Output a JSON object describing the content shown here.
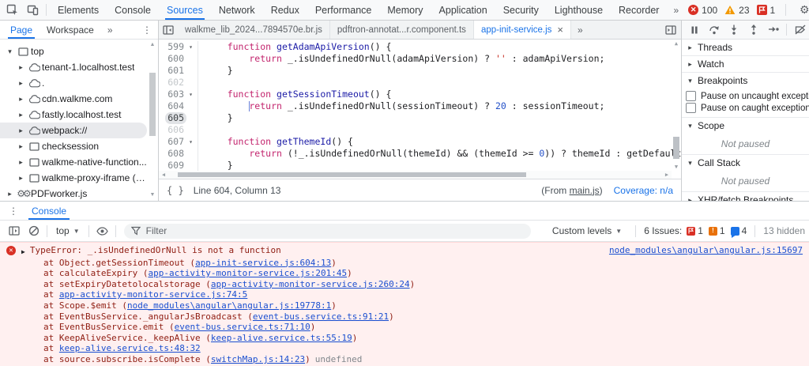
{
  "glyphs": {
    "more": "»",
    "menu": "⋮",
    "close": "×",
    "caret": "▼",
    "arrow_collapsed": "▸",
    "arrow_expanded": "▾",
    "up": "▲",
    "down": "▼",
    "left": "◀",
    "right": "▶",
    "gear": "⚙",
    "braces": "{ }",
    "flag": "⚑",
    "bang": "!",
    "x": "✕"
  },
  "topbar": {
    "tabs": [
      "Elements",
      "Console",
      "Sources",
      "Network",
      "Redux",
      "Performance",
      "Memory",
      "Application",
      "Security",
      "Lighthouse",
      "Recorder"
    ],
    "active": "Sources",
    "error_count": "100",
    "warning_count": "23",
    "issue_count": "1"
  },
  "sidebar": {
    "tabs": [
      "Page",
      "Workspace"
    ],
    "active": "Page",
    "tree": [
      {
        "label": "top",
        "icon": "frame",
        "expanded": true,
        "depth": 0
      },
      {
        "label": "tenant-1.localhost.test",
        "icon": "cloud",
        "depth": 1
      },
      {
        "label": ".",
        "icon": "cloud",
        "depth": 1
      },
      {
        "label": "cdn.walkme.com",
        "icon": "cloud",
        "depth": 1
      },
      {
        "label": "fastly.localhost.test",
        "icon": "cloud",
        "depth": 1
      },
      {
        "label": "webpack://",
        "icon": "cloud",
        "depth": 1,
        "selected": true
      },
      {
        "label": "checksession",
        "icon": "frame",
        "depth": 1
      },
      {
        "label": "walkme-native-function...",
        "icon": "frame",
        "depth": 1
      },
      {
        "label": "walkme-proxy-iframe (a...",
        "icon": "frame",
        "depth": 1
      },
      {
        "label": "PDFworker.js",
        "icon": "worker",
        "depth": 0
      }
    ]
  },
  "editor": {
    "tabs": [
      {
        "label": "walkme_lib_2024...7894570e.br.js",
        "active": false,
        "closable": false
      },
      {
        "label": "pdftron-annotat...r.component.ts",
        "active": false,
        "closable": false
      },
      {
        "label": "app-init-service.js",
        "active": true,
        "closable": true
      }
    ],
    "lines": [
      {
        "num": "599",
        "fold": true,
        "tokens": [
          [
            "kw",
            "    function"
          ],
          [
            "fn",
            " getAdamApiVersion"
          ],
          [
            "pl",
            "() {"
          ]
        ]
      },
      {
        "num": "600",
        "tokens": [
          [
            "kw",
            "        return"
          ],
          [
            "pl",
            " _.isUndefinedOrNull(adamApiVersion) ? "
          ],
          [
            "str",
            "''"
          ],
          [
            "pl",
            " : adamApiVersion;"
          ]
        ]
      },
      {
        "num": "601",
        "tokens": [
          [
            "pl",
            "    }"
          ]
        ]
      },
      {
        "num": "602",
        "dim": true,
        "tokens": []
      },
      {
        "num": "603",
        "fold": true,
        "tokens": [
          [
            "kw",
            "    function"
          ],
          [
            "fn",
            " getSessionTimeout"
          ],
          [
            "pl",
            "() {"
          ]
        ]
      },
      {
        "num": "604",
        "cursor": true,
        "tokens": [
          [
            "kw",
            "        return"
          ],
          [
            "pl",
            " _.isUndefinedOrNull(sessionTimeout) ? "
          ],
          [
            "num",
            "20"
          ],
          [
            "pl",
            " : sessionTimeout;"
          ]
        ]
      },
      {
        "num": "605",
        "hl": true,
        "tokens": [
          [
            "pl",
            "    }"
          ]
        ]
      },
      {
        "num": "606",
        "dim": true,
        "tokens": []
      },
      {
        "num": "607",
        "fold": true,
        "tokens": [
          [
            "kw",
            "    function"
          ],
          [
            "fn",
            " getThemeId"
          ],
          [
            "pl",
            "() {"
          ]
        ]
      },
      {
        "num": "608",
        "tokens": [
          [
            "kw",
            "        return"
          ],
          [
            "pl",
            " (!_.isUndefinedOrNull(themeId) && (themeId >= "
          ],
          [
            "num",
            "0"
          ],
          [
            "pl",
            ")) ? themeId : getDefaultThem"
          ]
        ]
      },
      {
        "num": "609",
        "tokens": [
          [
            "pl",
            "    }"
          ]
        ]
      }
    ],
    "status": {
      "line_col": "Line 604, Column 13",
      "from_prefix": "(From ",
      "from_link": "main.js",
      "from_suffix": ")",
      "coverage": "Coverage: n/a"
    }
  },
  "debugger": {
    "sections": [
      {
        "label": "Threads",
        "collapsed": true
      },
      {
        "label": "Watch",
        "collapsed": true
      },
      {
        "label": "Breakpoints",
        "collapsed": false,
        "checkboxes": [
          "Pause on uncaught exceptions",
          "Pause on caught exceptions"
        ]
      },
      {
        "label": "Scope",
        "collapsed": false,
        "empty": "Not paused"
      },
      {
        "label": "Call Stack",
        "collapsed": false,
        "empty": "Not paused"
      },
      {
        "label": "XHR/fetch Breakpoints",
        "collapsed": true
      }
    ]
  },
  "console": {
    "tab": "Console",
    "context": "top",
    "filter_placeholder": "Filter",
    "custom_levels": "Custom levels",
    "issues_label": "6 Issues:",
    "issue_badges": [
      {
        "type": "error",
        "count": "1"
      },
      {
        "type": "warning",
        "count": "1"
      },
      {
        "type": "info",
        "count": "4"
      }
    ],
    "hidden": "13 hidden",
    "error": {
      "message": "TypeError: _.isUndefinedOrNull is not a function",
      "source_link": "node_modules\\angular\\angular.js:15697",
      "stack": [
        {
          "prefix": "at Object.getSessionTimeout (",
          "link": "app-init-service.js:604:13",
          "suffix": ")"
        },
        {
          "prefix": "at calculateExpiry (",
          "link": "app-activity-monitor-service.js:201:45",
          "suffix": ")"
        },
        {
          "prefix": "at setExpiryDatetolocalstorage (",
          "link": "app-activity-monitor-service.js:260:24",
          "suffix": ")"
        },
        {
          "prefix": "at ",
          "link": "app-activity-monitor-service.js:74:5",
          "suffix": ""
        },
        {
          "prefix": "at Scope.$emit (",
          "link": "node_modules\\angular\\angular.js:19778:1",
          "suffix": ")"
        },
        {
          "prefix": "at EventBusService._angularJsBroadcast (",
          "link": "event-bus.service.ts:91:21",
          "suffix": ")"
        },
        {
          "prefix": "at EventBusService.emit (",
          "link": "event-bus.service.ts:71:10",
          "suffix": ")"
        },
        {
          "prefix": "at KeepAliveService._keepAlive (",
          "link": "keep-alive.service.ts:55:19",
          "suffix": ")"
        },
        {
          "prefix": "at ",
          "link": "keep-alive.service.ts:48:32",
          "suffix": ""
        },
        {
          "prefix": "at source.subscribe.isComplete (",
          "link": "switchMap.js:14:23",
          "suffix": ")",
          "trailing": "undefined"
        }
      ]
    }
  }
}
